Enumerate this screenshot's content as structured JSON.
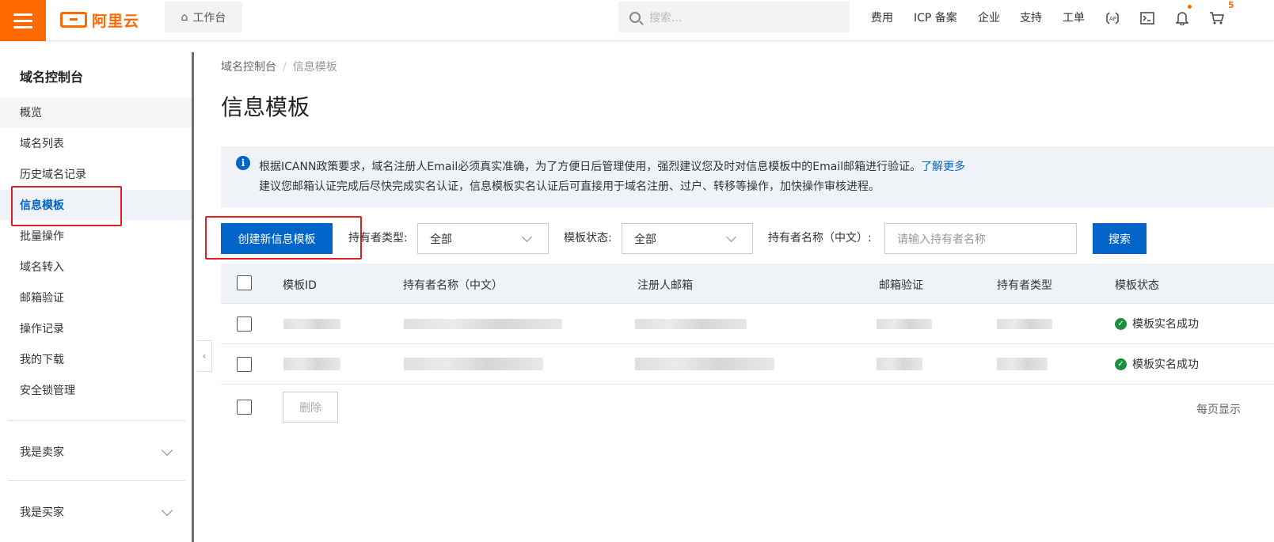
{
  "header": {
    "brand": "阿里云",
    "workbench": "工作台",
    "search_placeholder": "搜索...",
    "nav": [
      "费用",
      "ICP 备案",
      "企业",
      "支持",
      "工单"
    ],
    "cart_count": "5",
    "brand_color": "#ff6a00"
  },
  "sidebar": {
    "title": "域名控制台",
    "items": [
      "概览",
      "域名列表",
      "历史域名记录",
      "信息模板",
      "批量操作",
      "域名转入",
      "邮箱验证",
      "操作记录",
      "我的下载",
      "安全锁管理"
    ],
    "active_item": "信息模板",
    "groups": [
      "我是卖家",
      "我是买家"
    ]
  },
  "breadcrumb": {
    "root": "域名控制台",
    "current": "信息模板"
  },
  "page_title": "信息模板",
  "notice": {
    "line1": "根据ICANN政策要求，域名注册人Email必须真实准确，为了方便日后管理使用，强烈建议您及时对信息模板中的Email邮箱进行验证。",
    "link": "了解更多",
    "line2": "建议您邮箱认证完成后尽快完成实名认证，信息模板实名认证后可直接用于域名注册、过户、转移等操作，加快操作审核进程。"
  },
  "toolbar": {
    "create_button": "创建新信息模板",
    "holder_type_label": "持有者类型:",
    "holder_type_value": "全部",
    "status_label": "模板状态:",
    "status_value": "全部",
    "holder_name_label": "持有者名称（中文）:",
    "holder_name_placeholder": "请输入持有者名称",
    "search_button": "搜索"
  },
  "table": {
    "columns": [
      "模板ID",
      "持有者名称（中文）",
      "注册人邮箱",
      "邮箱验证",
      "持有者类型",
      "模板状态"
    ],
    "rows": [
      {
        "status": "模板实名成功"
      },
      {
        "status": "模板实名成功"
      }
    ],
    "delete_button": "删除",
    "per_page_label": "每页显示"
  },
  "colors": {
    "accent": "#0064c8",
    "success": "#1e8e3e",
    "highlight": "#e02020"
  }
}
